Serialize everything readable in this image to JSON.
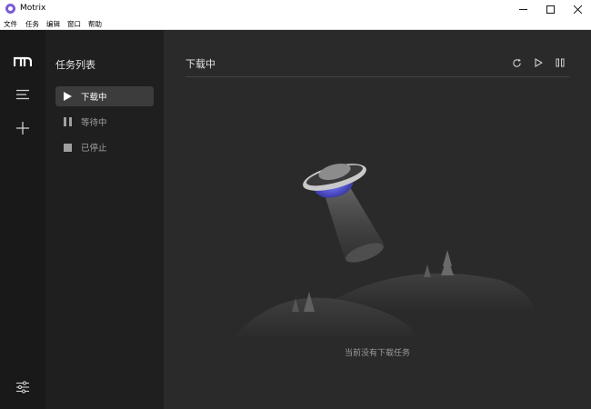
{
  "window": {
    "title": "Motrix"
  },
  "menubar": {
    "items": [
      "文件",
      "任务",
      "编辑",
      "窗口",
      "帮助"
    ]
  },
  "subnav": {
    "heading": "任务列表",
    "items": [
      {
        "label": "下载中",
        "icon": "play-icon",
        "active": true
      },
      {
        "label": "等待中",
        "icon": "pause-icon",
        "active": false
      },
      {
        "label": "已停止",
        "icon": "stop-icon",
        "active": false
      }
    ]
  },
  "main": {
    "title": "下载中",
    "empty_text": "当前没有下载任务"
  },
  "colors": {
    "rail": "#191919",
    "subnav": "#1f1f1f",
    "main": "#2a2a2a",
    "accent": "#5b5bd6"
  }
}
